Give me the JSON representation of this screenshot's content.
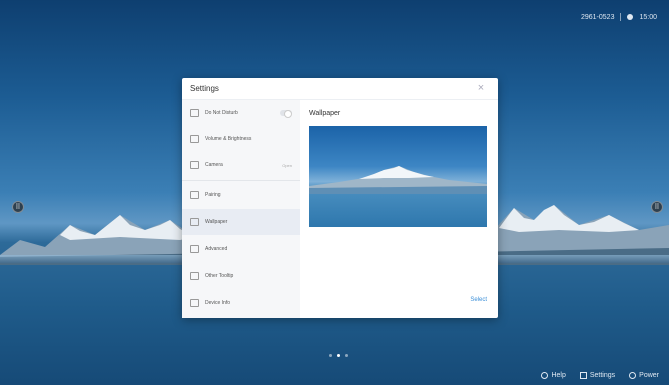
{
  "topbar": {
    "date": "2961-0523",
    "time": "15:00"
  },
  "dialog": {
    "title": "Settings",
    "close_icon": "close-icon"
  },
  "sidebar": {
    "items": [
      {
        "label": "Do Not Disturb",
        "icon": "do-not-disturb-icon",
        "right": ""
      },
      {
        "label": "Volume & Brightness",
        "icon": "volume-brightness-icon",
        "right": ""
      },
      {
        "label": "Camera",
        "icon": "camera-icon",
        "right": "Open"
      },
      {
        "label": "Pairing",
        "icon": "pairing-icon",
        "right": ""
      },
      {
        "label": "Wallpaper",
        "icon": "wallpaper-icon",
        "right": ""
      },
      {
        "label": "Advanced",
        "icon": "advanced-icon",
        "right": ""
      },
      {
        "label": "Other Tooltip",
        "icon": "other-tool-icon",
        "right": ""
      },
      {
        "label": "Device Info",
        "icon": "device-info-icon",
        "right": ""
      }
    ],
    "selected": "Wallpaper"
  },
  "content": {
    "title": "Wallpaper",
    "select_label": "Select"
  },
  "bottombar": {
    "help": "Help",
    "settings": "Settings",
    "power": "Power"
  },
  "pager": {
    "pages": 3,
    "active": 2
  },
  "colors": {
    "accent": "#3b8fd8",
    "dialog_bg": "#ffffff",
    "sidebar_bg": "#f6f7f9"
  }
}
